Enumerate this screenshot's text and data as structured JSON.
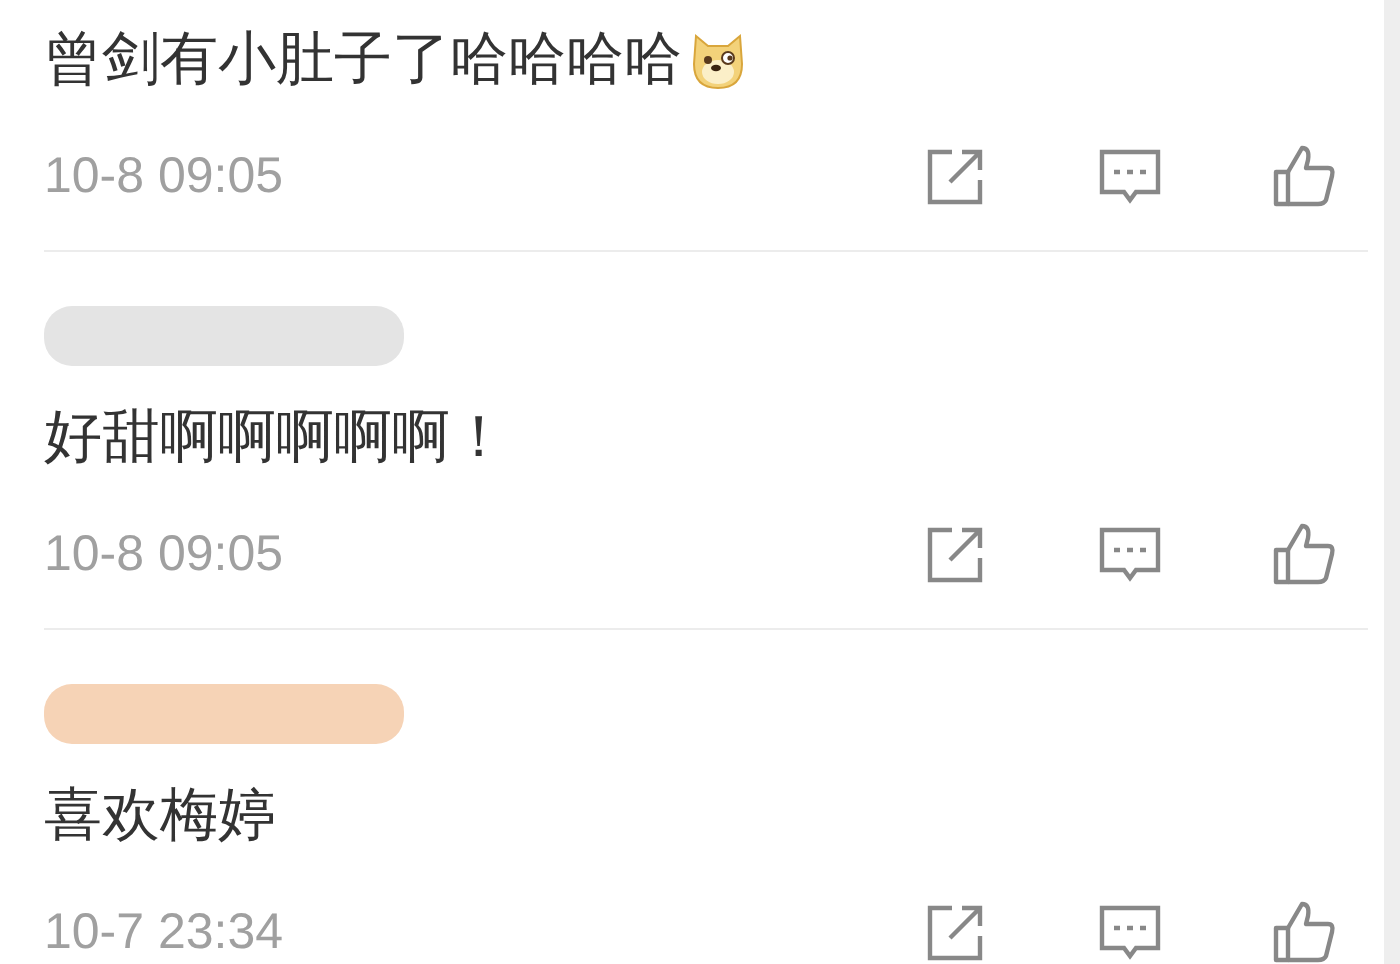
{
  "comments": [
    {
      "text": "曾剑有小肚子了哈哈哈哈",
      "emoji": true,
      "time": "10-8 09:05"
    },
    {
      "name": {
        "color": "#e4e4e4"
      },
      "text": "好甜啊啊啊啊啊！",
      "emoji": false,
      "time": "10-8 09:05"
    },
    {
      "name": {
        "color": "#f6d3b6"
      },
      "text": "喜欢梅婷",
      "emoji": false,
      "time": "10-7 23:34"
    }
  ]
}
